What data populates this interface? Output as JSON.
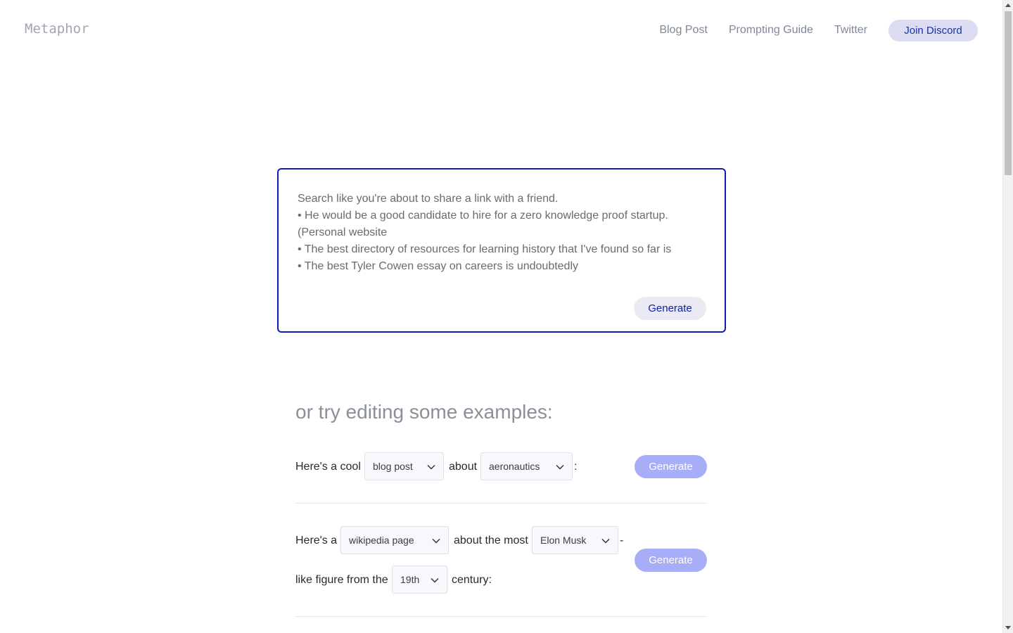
{
  "header": {
    "logo": "Metaphor",
    "nav": [
      "Blog Post",
      "Prompting Guide",
      "Twitter"
    ],
    "discord_label": "Join Discord"
  },
  "search": {
    "placeholder_lines": [
      "Search like you're about to share a link with a friend.",
      "• He would be a good candidate to hire for a zero knowledge proof startup.",
      "(Personal website",
      "• The best directory of resources for learning history that I've found so far is",
      "• The best Tyler Cowen essay on careers is undoubtedly"
    ],
    "generate_label": "Generate"
  },
  "examples": {
    "heading": "or try editing some examples:",
    "example1": {
      "prefix": "Here's a cool",
      "type_select": "blog post",
      "middle": "about",
      "topic_select": "aeronautics",
      "suffix": ":",
      "generate_label": "Generate"
    },
    "example2": {
      "prefix": "Here's a",
      "type_select": "wikipedia page",
      "middle": "about the most",
      "person_select": "Elon Musk",
      "dash": "-",
      "line2_prefix": "like figure from the",
      "century_select": "19th",
      "suffix": "century:",
      "generate_label": "Generate"
    }
  },
  "colors": {
    "accent": "#0d1fb5",
    "generate_disabled": "#a7adf6",
    "discord_bg": "#dcdcf3"
  }
}
